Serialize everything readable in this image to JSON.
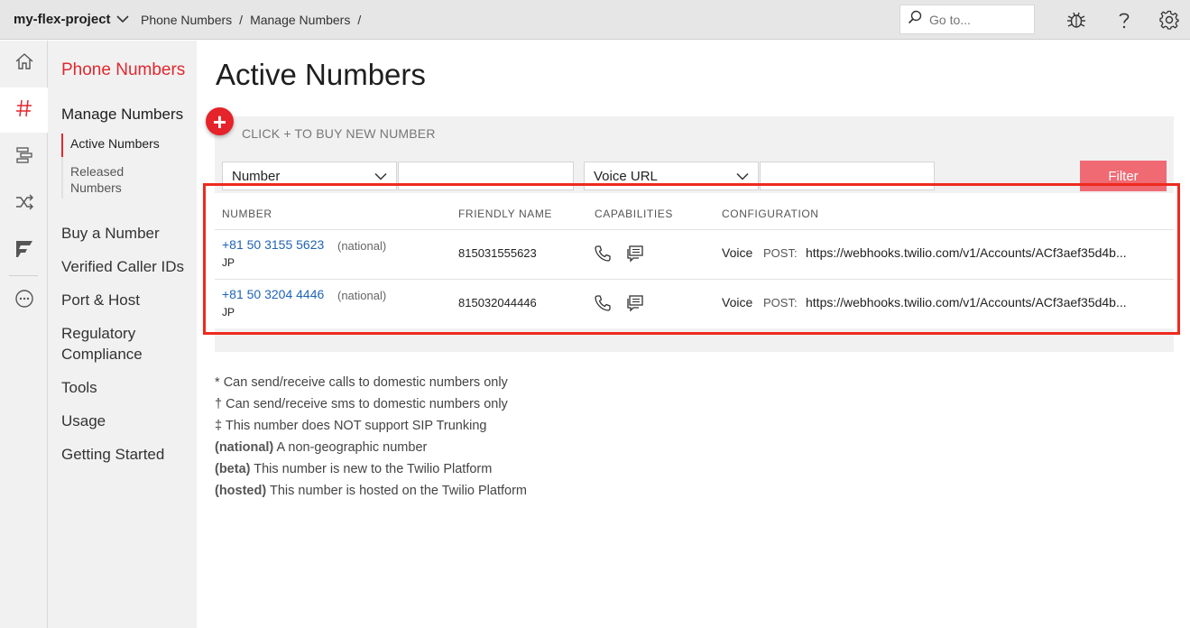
{
  "topbar": {
    "project": "my-flex-project",
    "breadcrumbs": [
      "Phone Numbers",
      "Manage Numbers"
    ],
    "search_placeholder": "Go to..."
  },
  "rail": {
    "icons": [
      "home-icon",
      "hash-icon",
      "studio-icon",
      "shuffle-icon",
      "flex-icon",
      "more-icon"
    ],
    "active": "hash-icon"
  },
  "subnav": {
    "title": "Phone Numbers",
    "section": "Manage Numbers",
    "sub_items": [
      {
        "label": "Active Numbers",
        "active": true
      },
      {
        "label": "Released Numbers",
        "active": false
      }
    ],
    "links": [
      "Buy a Number",
      "Verified Caller IDs",
      "Port & Host",
      "Regulatory Compliance",
      "Tools",
      "Usage",
      "Getting Started"
    ]
  },
  "main": {
    "title": "Active Numbers",
    "buy_hint": "CLICK + TO BUY NEW NUMBER",
    "filter": {
      "field1": "Number",
      "field2": "Voice URL",
      "button": "Filter"
    },
    "table": {
      "headers": [
        "NUMBER",
        "FRIENDLY NAME",
        "CAPABILITIES",
        "CONFIGURATION"
      ],
      "rows": [
        {
          "number": "+81 50 3155 5623",
          "type": "(national)",
          "country": "JP",
          "friendly_name": "815031555623",
          "capabilities": [
            "voice",
            "sms"
          ],
          "config_kind": "Voice",
          "config_method": "POST:",
          "config_url": "https://webhooks.twilio.com/v1/Accounts/ACf3aef35d4b..."
        },
        {
          "number": "+81 50 3204 4446",
          "type": "(national)",
          "country": "JP",
          "friendly_name": "815032044446",
          "capabilities": [
            "voice",
            "sms"
          ],
          "config_kind": "Voice",
          "config_method": "POST:",
          "config_url": "https://webhooks.twilio.com/v1/Accounts/ACf3aef35d4b..."
        }
      ]
    },
    "notes": [
      {
        "mark": "*",
        "text": "Can send/receive calls to domestic numbers only"
      },
      {
        "mark": "†",
        "text": "Can send/receive sms to domestic numbers only"
      },
      {
        "mark": "‡",
        "text": "This number does NOT support SIP Trunking"
      },
      {
        "mark": "(national)",
        "text": "A non-geographic number"
      },
      {
        "mark": "(beta)",
        "text": "This number is new to the Twilio Platform"
      },
      {
        "mark": "(hosted)",
        "text": "This number is hosted on the Twilio Platform"
      }
    ]
  },
  "colors": {
    "accent": "#e0282f",
    "link": "#1f64b5",
    "filter_button": "#f06a74",
    "highlight_box": "#ee2a1f"
  }
}
